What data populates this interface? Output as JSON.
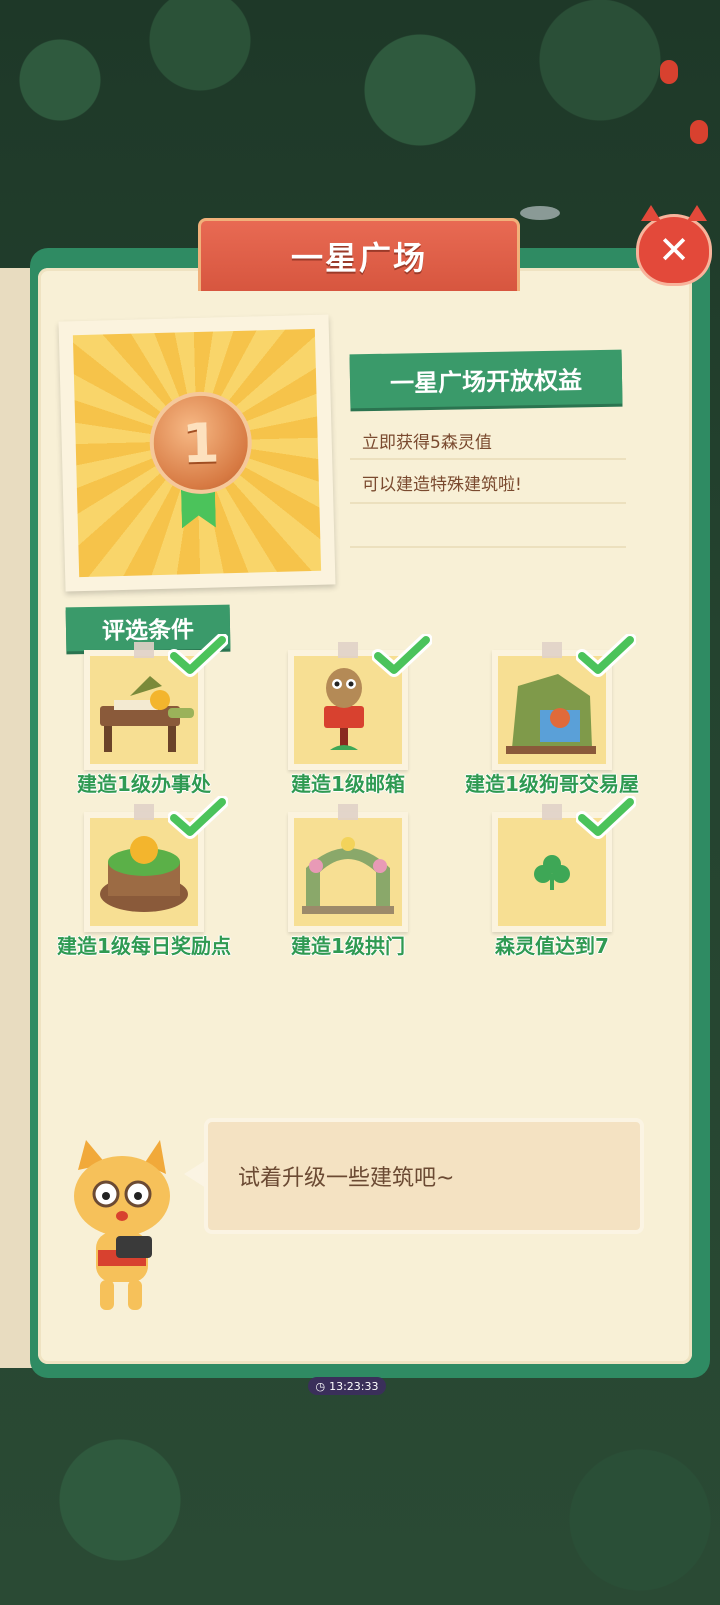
{
  "title": "一星广场",
  "close": {
    "glyph": "✕"
  },
  "medal": {
    "number": "1"
  },
  "benefits": {
    "heading": "一星广场开放权益",
    "lines": [
      "立即获得5森灵值",
      "可以建造特殊建筑啦!"
    ]
  },
  "criteria": {
    "heading": "评选条件",
    "items": [
      {
        "label": "建造1级办事处",
        "icon": "office-building",
        "done": true
      },
      {
        "label": "建造1级邮箱",
        "icon": "owl-mailbox",
        "done": true
      },
      {
        "label": "建造1级狗哥交易屋",
        "icon": "dog-trading-hut",
        "done": true
      },
      {
        "label": "建造1级每日奖励点",
        "icon": "daily-reward-stump",
        "done": true
      },
      {
        "label": "建造1级拱门",
        "icon": "flower-arch",
        "done": true
      },
      {
        "label": "森灵值达到7",
        "icon": "clover",
        "done": true
      }
    ]
  },
  "hint": {
    "text": "试着升级一些建筑吧~"
  },
  "timer": {
    "text": "13:23:33"
  },
  "colors": {
    "accent_green": "#3a9a6a",
    "title_red": "#d7563f",
    "check_green": "#4bc35b"
  }
}
